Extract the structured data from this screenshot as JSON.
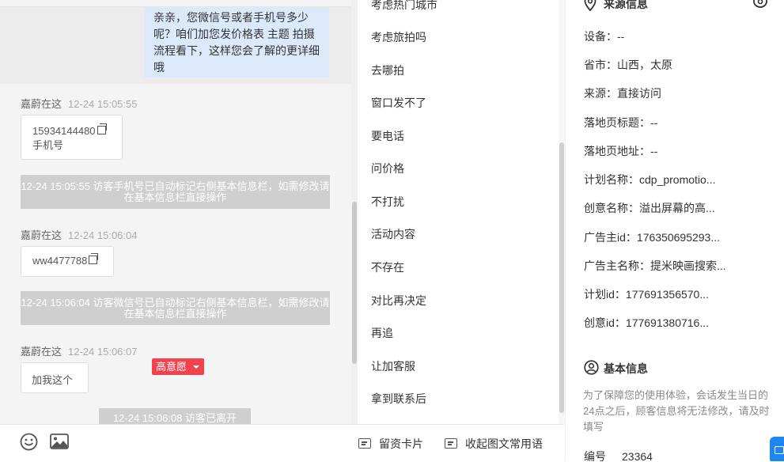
{
  "chat": {
    "agent_message": "亲亲，您微信号或者手机号多少呢？咱们加您发价格表 主题 拍摄流程看下，这样您会了解的更详细哦",
    "messages": [
      {
        "sender": "嘉蔚在这",
        "time": "12-24 15:05:55",
        "value": "15934144480",
        "sub": "手机号"
      },
      {
        "sender": "嘉蔚在这",
        "time": "12-24 15:06:04",
        "value": "ww4477788"
      },
      {
        "sender": "嘉蔚在这",
        "time": "12-24 15:06:07",
        "value": "加我这个"
      }
    ],
    "system": [
      "12-24 15:05:55 访客手机号已自动标记右侧基本信息栏，如需修改请在基本信息栏直接操作",
      "12-24 15:06:04 访客微信号已自动标记右侧基本信息栏，如需修改请在基本信息栏直接操作"
    ],
    "left_notice": "12-24 15:06:08 访客已离开"
  },
  "toolbar": {
    "card_label": "留资卡片",
    "phrases_label": "收起图文常用语"
  },
  "phrases": [
    "考虑热门城市",
    "考虑旅拍吗",
    "去哪拍",
    "窗口发不了",
    "要电话",
    "问价格",
    "不打扰",
    "活动内容",
    "不存在",
    "对比再决定",
    "再追",
    "让加客服",
    "拿到联系后"
  ],
  "source": {
    "title": "来源信息",
    "rows": [
      {
        "label": "设备：",
        "value": "--"
      },
      {
        "label": "省市：",
        "value": "山西，太原"
      },
      {
        "label": "来源：",
        "value": "直接访问"
      },
      {
        "label": "落地页标题：",
        "value": "--"
      },
      {
        "label": "落地页地址：",
        "value": "--"
      },
      {
        "label": "计划名称：",
        "value": "cdp_promotio..."
      },
      {
        "label": "创意名称：",
        "value": "溢出屏幕的高..."
      },
      {
        "label": "广告主id：",
        "value": "176350695293..."
      },
      {
        "label": "广告主名称：",
        "value": "提米映画搜索..."
      },
      {
        "label": "计划id：",
        "value": "177691356570..."
      },
      {
        "label": "创意id：",
        "value": "177691380716..."
      }
    ]
  },
  "basic": {
    "title": "基本信息",
    "tag": "高意愿",
    "notice": "为了保障您的使用体验，会话发生当日的24点之后，顾客信息将无法修改，请及时填写",
    "id_label": "编号",
    "id_value": "23364"
  }
}
